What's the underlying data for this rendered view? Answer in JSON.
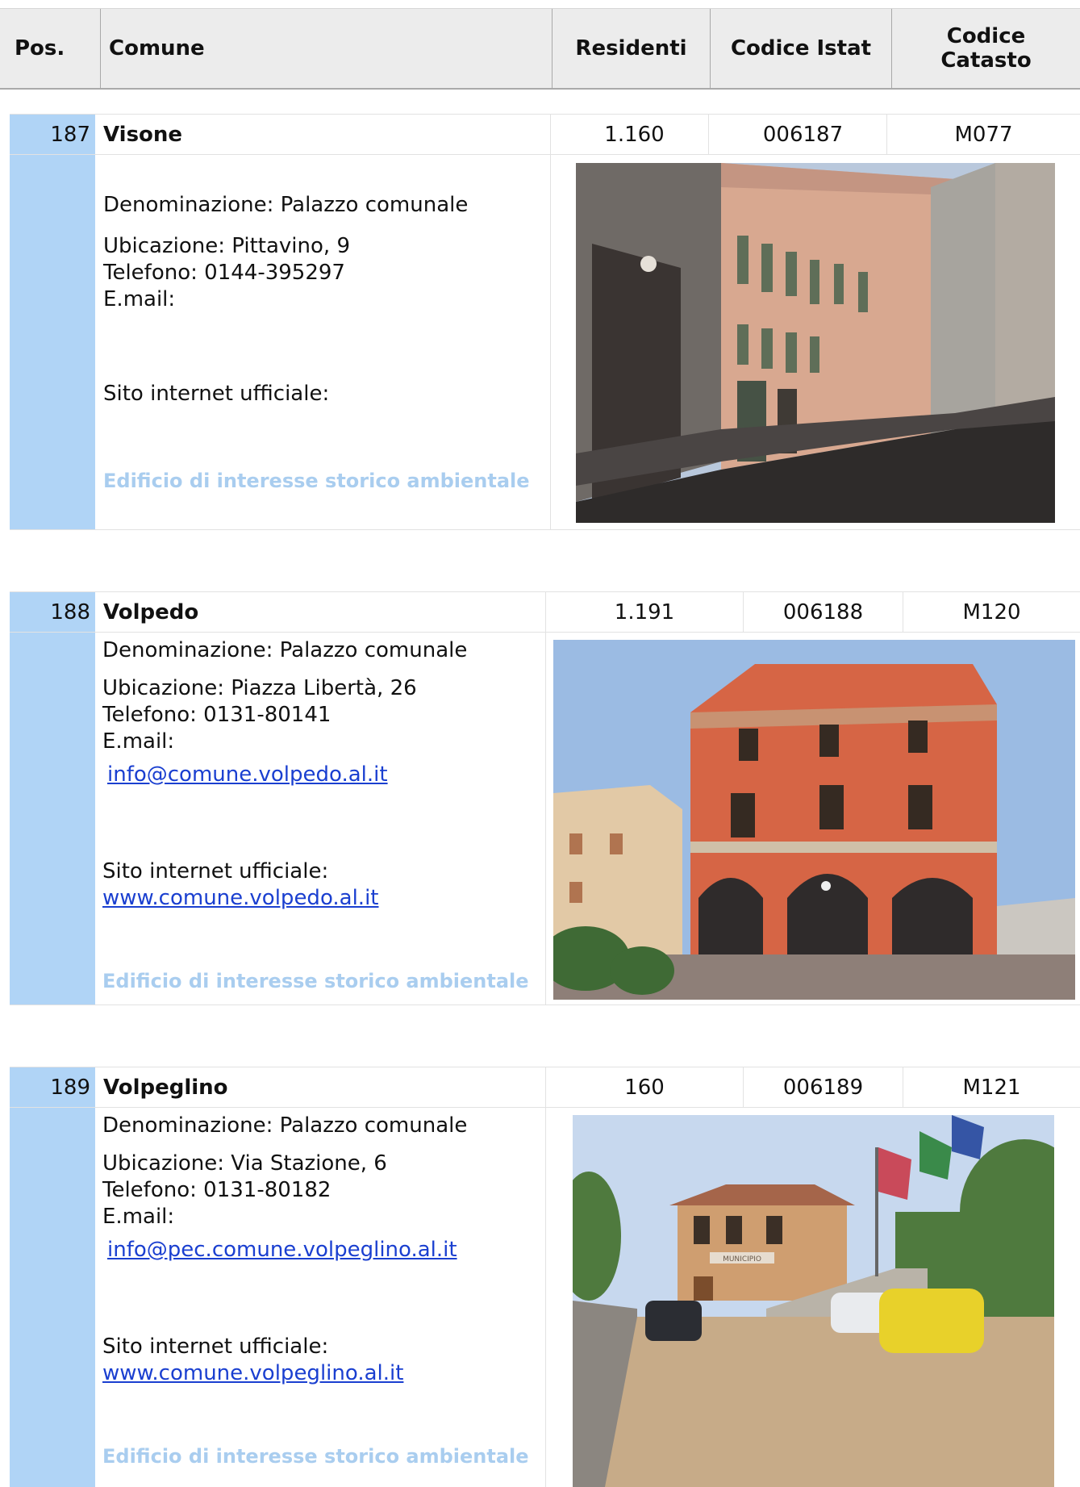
{
  "header": {
    "pos": "Pos.",
    "comune": "Comune",
    "residenti": "Residenti",
    "istat": "Codice Istat",
    "catasto_line1": "Codice",
    "catasto_line2": "Catasto"
  },
  "entries": [
    {
      "pos": "187",
      "name": "Visone",
      "residenti": "1.160",
      "istat": "006187",
      "catasto": "M077",
      "denominazione": "Denominazione: Palazzo comunale",
      "ubicazione": "Ubicazione: Pittavino, 9",
      "telefono": "Telefono: 0144-395297",
      "email_label": "E.mail:",
      "email": "",
      "sito_label": "Sito internet ufficiale:",
      "sito": "",
      "edificio": "Edificio di interesse storico ambientale",
      "photo_alt": "street-with-town-hall-photo"
    },
    {
      "pos": "188",
      "name": "Volpedo",
      "residenti": "1.191",
      "istat": "006188",
      "catasto": "M120",
      "denominazione": "Denominazione: Palazzo comunale",
      "ubicazione": "Ubicazione: Piazza Libertà, 26",
      "telefono": "Telefono: 0131-80141",
      "email_label": "E.mail:",
      "email": "info@comune.volpedo.al.it",
      "sito_label": "Sito internet ufficiale:",
      "sito": "www.comune.volpedo.al.it",
      "edificio": "Edificio di interesse storico ambientale",
      "photo_alt": "red-palazzo-with-arcades-photo"
    },
    {
      "pos": "189",
      "name": "Volpeglino",
      "residenti": "160",
      "istat": "006189",
      "catasto": "M121",
      "denominazione": "Denominazione: Palazzo comunale",
      "ubicazione": "Ubicazione: Via Stazione, 6",
      "telefono": "Telefono: 0131-80182",
      "email_label": "E.mail:",
      "email": "info@pec.comune.volpeglino.al.it",
      "sito_label": "Sito internet ufficiale:",
      "sito": "www.comune.volpeglino.al.it",
      "edificio": "Edificio di interesse storico ambientale",
      "photo_alt": "municipio-building-with-cars-photo",
      "photo_sign": "MUNICIPIO"
    }
  ]
}
